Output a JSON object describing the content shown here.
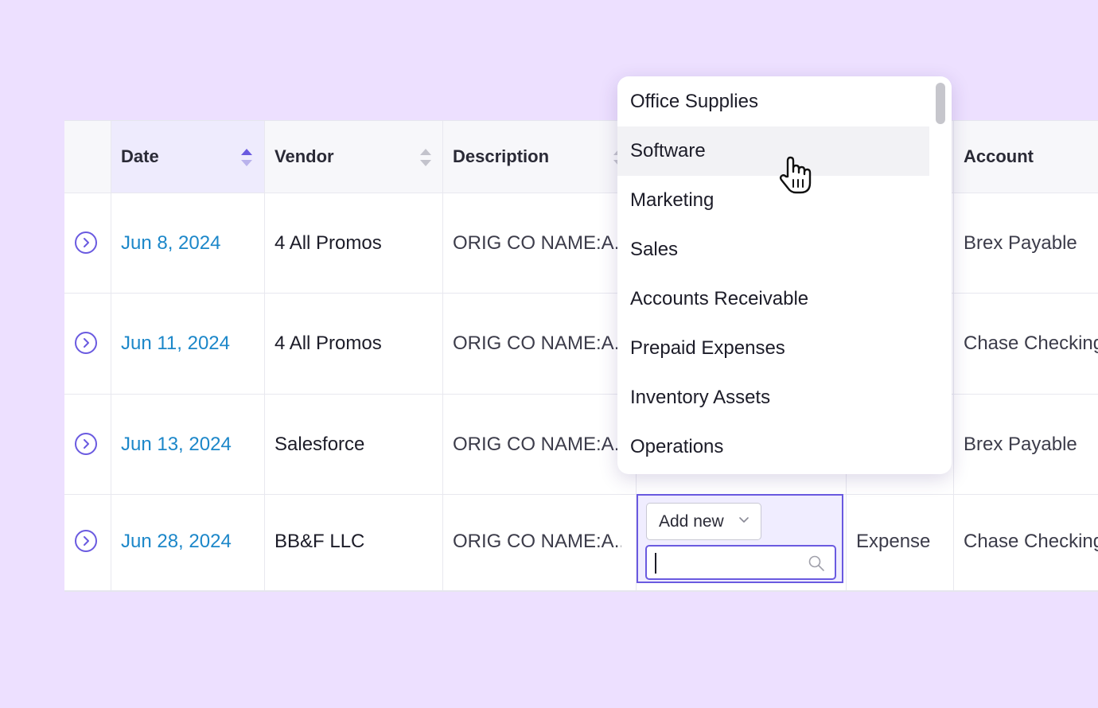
{
  "table": {
    "headers": {
      "date": "Date",
      "vendor": "Vendor",
      "description": "Description",
      "account": "Account"
    },
    "rows": [
      {
        "date": "Jun 8, 2024",
        "vendor": "4 All Promos",
        "description": "ORIG CO NAME:A...",
        "account": "Brex Payable"
      },
      {
        "date": "Jun 11, 2024",
        "vendor": "4 All Promos",
        "description": "ORIG CO NAME:A...",
        "account": "Chase Checking"
      },
      {
        "date": "Jun 13, 2024",
        "vendor": "Salesforce",
        "description": "ORIG CO NAME:A...",
        "account": "Brex Payable"
      },
      {
        "date": "Jun 28, 2024",
        "vendor": "BB&F LLC",
        "description": "ORIG CO NAME:A...",
        "type": "Expense",
        "account": "Chase Checking"
      }
    ]
  },
  "editor": {
    "add_new_label": "Add new",
    "search_value": ""
  },
  "dropdown": {
    "options": [
      "Office Supplies",
      "Software",
      "Marketing",
      "Sales",
      "Accounts Receivable",
      "Prepaid Expenses",
      "Inventory Assets",
      "Operations"
    ],
    "hovered": "Software"
  },
  "colors": {
    "accent": "#6a5ae0",
    "date_link": "#1c87c9",
    "background": "#ede0ff"
  },
  "icons": [
    "expand-row-icon",
    "sort-icon",
    "chevron-down-icon",
    "search-icon",
    "hand-cursor-icon"
  ]
}
